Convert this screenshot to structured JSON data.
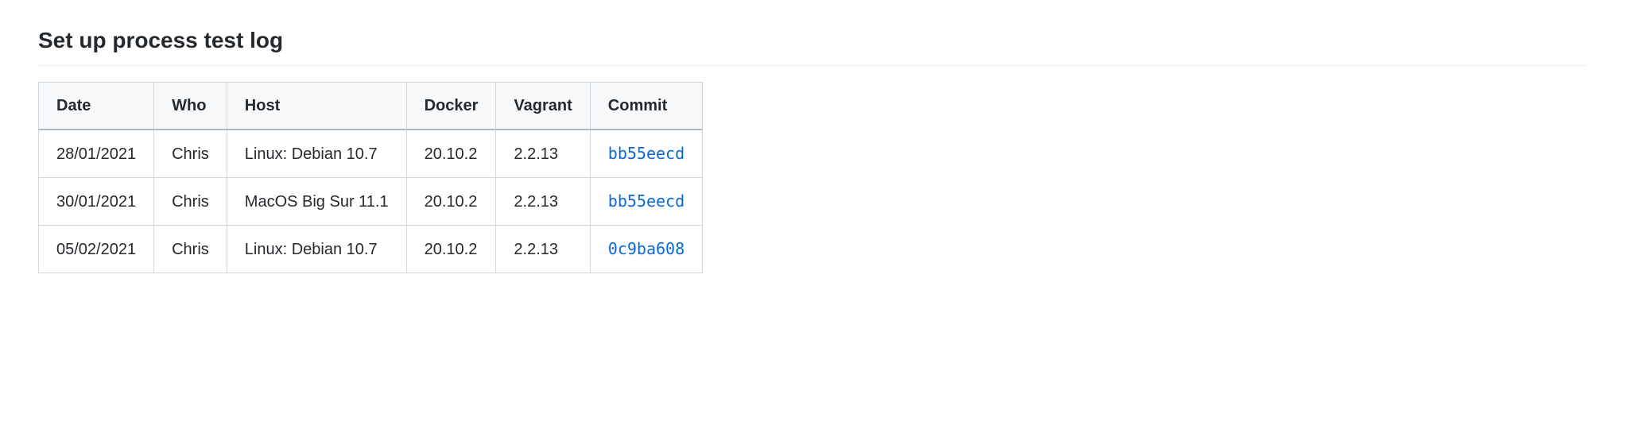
{
  "heading": "Set up process test log",
  "table": {
    "headers": {
      "date": "Date",
      "who": "Who",
      "host": "Host",
      "docker": "Docker",
      "vagrant": "Vagrant",
      "commit": "Commit"
    },
    "rows": [
      {
        "date": "28/01/2021",
        "who": "Chris",
        "host": "Linux: Debian 10.7",
        "docker": "20.10.2",
        "vagrant": "2.2.13",
        "commit": "bb55eecd"
      },
      {
        "date": "30/01/2021",
        "who": "Chris",
        "host": "MacOS Big Sur 11.1",
        "docker": "20.10.2",
        "vagrant": "2.2.13",
        "commit": "bb55eecd"
      },
      {
        "date": "05/02/2021",
        "who": "Chris",
        "host": "Linux: Debian 10.7",
        "docker": "20.10.2",
        "vagrant": "2.2.13",
        "commit": "0c9ba608"
      }
    ]
  },
  "colors": {
    "link": "#0969da",
    "border": "#d0d7de",
    "header_bg": "#f6f8fa"
  }
}
